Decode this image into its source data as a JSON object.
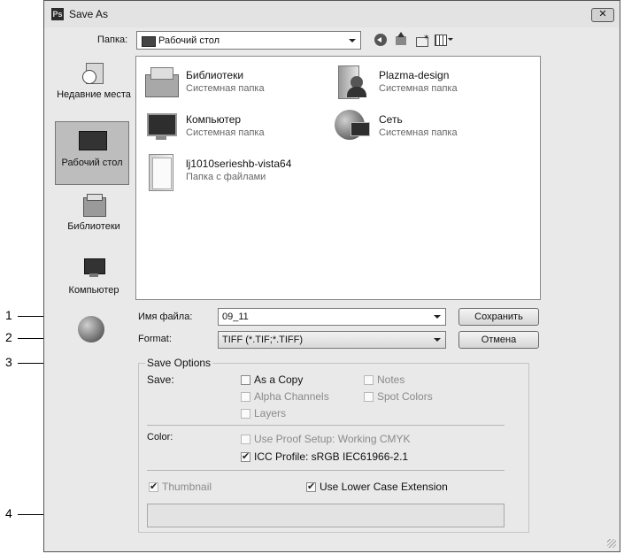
{
  "callouts": [
    "1",
    "2",
    "3",
    "4"
  ],
  "window": {
    "title": "Save As",
    "app_icon": "Ps",
    "close_label": "✕"
  },
  "location": {
    "label": "Папка:",
    "value": "Рабочий стол"
  },
  "sidebar": {
    "items": [
      {
        "label": "Недавние места",
        "icon": "recent-places-icon"
      },
      {
        "label": "Рабочий стол",
        "icon": "desktop-icon",
        "selected": true
      },
      {
        "label": "Библиотеки",
        "icon": "libraries-icon"
      },
      {
        "label": "Компьютер",
        "icon": "computer-icon"
      },
      {
        "label": "",
        "icon": "network-icon"
      }
    ]
  },
  "files": [
    {
      "name": "Библиотеки",
      "type": "Системная папка",
      "icon": "libraries-folder-icon"
    },
    {
      "name": "Plazma-design",
      "type": "Системная папка",
      "icon": "user-folder-icon"
    },
    {
      "name": "Компьютер",
      "type": "Системная папка",
      "icon": "computer-icon"
    },
    {
      "name": "Сеть",
      "type": "Системная папка",
      "icon": "network-icon"
    },
    {
      "name": "lj1010serieshb-vista64",
      "type": "Папка с файлами",
      "icon": "folder-icon"
    }
  ],
  "filename": {
    "label": "Имя файла:",
    "value": "09_11"
  },
  "format": {
    "label": "Format:",
    "value": "TIFF (*.TIF;*.TIFF)"
  },
  "buttons": {
    "save": "Сохранить",
    "cancel": "Отмена"
  },
  "save_options": {
    "title": "Save Options",
    "save_label": "Save:",
    "as_a_copy": "As a Copy",
    "notes": "Notes",
    "alpha_channels": "Alpha Channels",
    "spot_colors": "Spot Colors",
    "layers": "Layers",
    "color_label": "Color:",
    "use_proof_setup": "Use Proof Setup:  Working CMYK",
    "icc_profile": "ICC Profile:  sRGB IEC61966-2.1",
    "thumbnail": "Thumbnail",
    "lower_case_ext": "Use Lower Case Extension"
  }
}
